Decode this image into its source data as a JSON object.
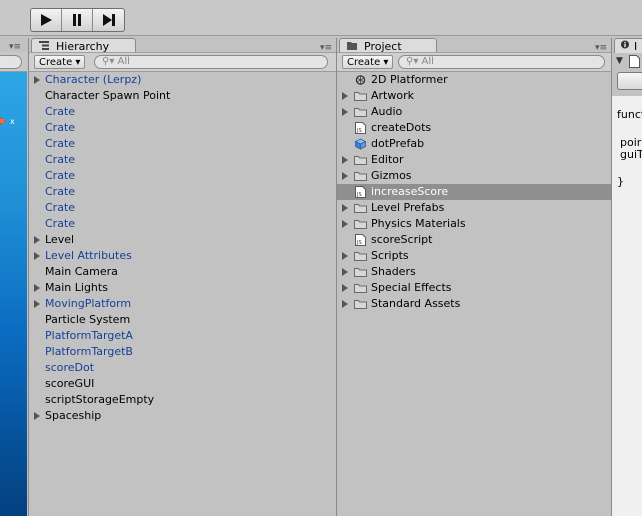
{
  "hierarchy": {
    "tab_label": "Hierarchy",
    "create_label": "Create",
    "search_placeholder": "All",
    "items": [
      {
        "label": "Character (Lerpz)",
        "expandable": true,
        "prefab": true
      },
      {
        "label": "Character Spawn Point",
        "expandable": false,
        "prefab": false
      },
      {
        "label": "Crate",
        "expandable": false,
        "prefab": true
      },
      {
        "label": "Crate",
        "expandable": false,
        "prefab": true
      },
      {
        "label": "Crate",
        "expandable": false,
        "prefab": true
      },
      {
        "label": "Crate",
        "expandable": false,
        "prefab": true
      },
      {
        "label": "Crate",
        "expandable": false,
        "prefab": true
      },
      {
        "label": "Crate",
        "expandable": false,
        "prefab": true
      },
      {
        "label": "Crate",
        "expandable": false,
        "prefab": true
      },
      {
        "label": "Crate",
        "expandable": false,
        "prefab": true
      },
      {
        "label": "Level",
        "expandable": true,
        "prefab": false
      },
      {
        "label": "Level Attributes",
        "expandable": true,
        "prefab": true
      },
      {
        "label": "Main Camera",
        "expandable": false,
        "prefab": false
      },
      {
        "label": "Main Lights",
        "expandable": true,
        "prefab": false
      },
      {
        "label": "MovingPlatform",
        "expandable": true,
        "prefab": true
      },
      {
        "label": "Particle System",
        "expandable": false,
        "prefab": false
      },
      {
        "label": "PlatformTargetA",
        "expandable": false,
        "prefab": true
      },
      {
        "label": "PlatformTargetB",
        "expandable": false,
        "prefab": true
      },
      {
        "label": "scoreDot",
        "expandable": false,
        "prefab": true
      },
      {
        "label": "scoreGUI",
        "expandable": false,
        "prefab": false
      },
      {
        "label": "scriptStorageEmpty",
        "expandable": false,
        "prefab": false
      },
      {
        "label": "Spaceship",
        "expandable": true,
        "prefab": false
      }
    ]
  },
  "project": {
    "tab_label": "Project",
    "create_label": "Create",
    "search_placeholder": "All",
    "items": [
      {
        "label": "2D Platformer",
        "type": "unity",
        "expandable": false,
        "selected": false
      },
      {
        "label": "Artwork",
        "type": "folder",
        "expandable": true,
        "selected": false
      },
      {
        "label": "Audio",
        "type": "folder",
        "expandable": true,
        "selected": false
      },
      {
        "label": "createDots",
        "type": "script",
        "expandable": false,
        "selected": false
      },
      {
        "label": "dotPrefab",
        "type": "prefab",
        "expandable": false,
        "selected": false
      },
      {
        "label": "Editor",
        "type": "folder",
        "expandable": true,
        "selected": false
      },
      {
        "label": "Gizmos",
        "type": "folder",
        "expandable": true,
        "selected": false
      },
      {
        "label": "increaseScore",
        "type": "script",
        "expandable": false,
        "selected": true
      },
      {
        "label": "Level Prefabs",
        "type": "folder",
        "expandable": true,
        "selected": false
      },
      {
        "label": "Physics Materials",
        "type": "folder",
        "expandable": true,
        "selected": false
      },
      {
        "label": "scoreScript",
        "type": "script",
        "expandable": false,
        "selected": false
      },
      {
        "label": "Scripts",
        "type": "folder",
        "expandable": true,
        "selected": false
      },
      {
        "label": "Shaders",
        "type": "folder",
        "expandable": true,
        "selected": false
      },
      {
        "label": "Special Effects",
        "type": "folder",
        "expandable": true,
        "selected": false
      },
      {
        "label": "Standard Assets",
        "type": "folder",
        "expandable": true,
        "selected": false
      }
    ]
  },
  "inspector": {
    "tab_label": "I",
    "code_lines": [
      "funct",
      "",
      "poir",
      "guiT",
      "",
      "}"
    ]
  },
  "colors": {
    "prefab_text": "#14409a",
    "selection": "#8f8f8f"
  }
}
